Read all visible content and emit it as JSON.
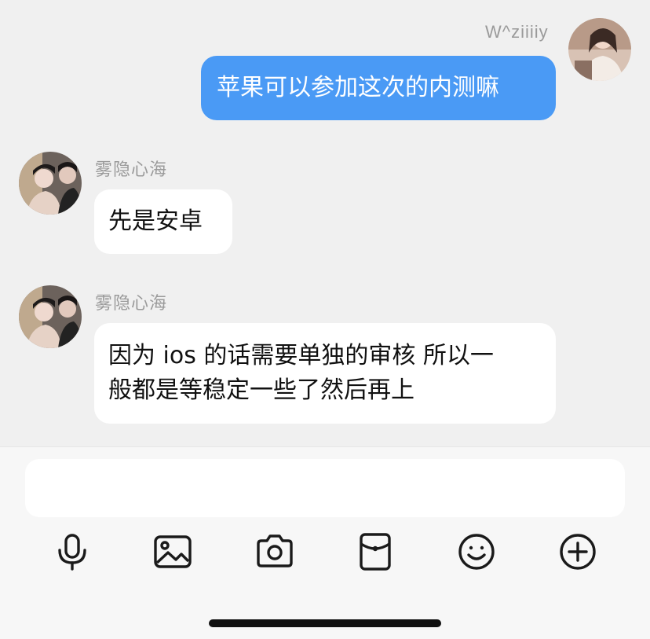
{
  "messages": [
    {
      "direction": "outgoing",
      "sender": "W^ziiiiy",
      "text": "苹果可以参加这次的内测嘛"
    },
    {
      "direction": "incoming",
      "sender": "雾隐心海",
      "text": "先是安卓"
    },
    {
      "direction": "incoming",
      "sender": "雾隐心海",
      "text_line1": "因为 ios 的话需要单独的审核 所以一",
      "text_line2": "般都是等稳定一些了然后再上"
    }
  ],
  "input": {
    "value": "",
    "placeholder": ""
  },
  "toolbar": [
    {
      "icon": "microphone-icon"
    },
    {
      "icon": "image-icon"
    },
    {
      "icon": "camera-icon"
    },
    {
      "icon": "red-packet-icon"
    },
    {
      "icon": "emoji-icon"
    },
    {
      "icon": "plus-circle-icon"
    }
  ],
  "colors": {
    "background": "#f0f0f0",
    "self_bubble": "#4a9af5",
    "other_bubble": "#ffffff",
    "name_text": "#9a9a9a",
    "icon_stroke": "#1a1a1a"
  }
}
